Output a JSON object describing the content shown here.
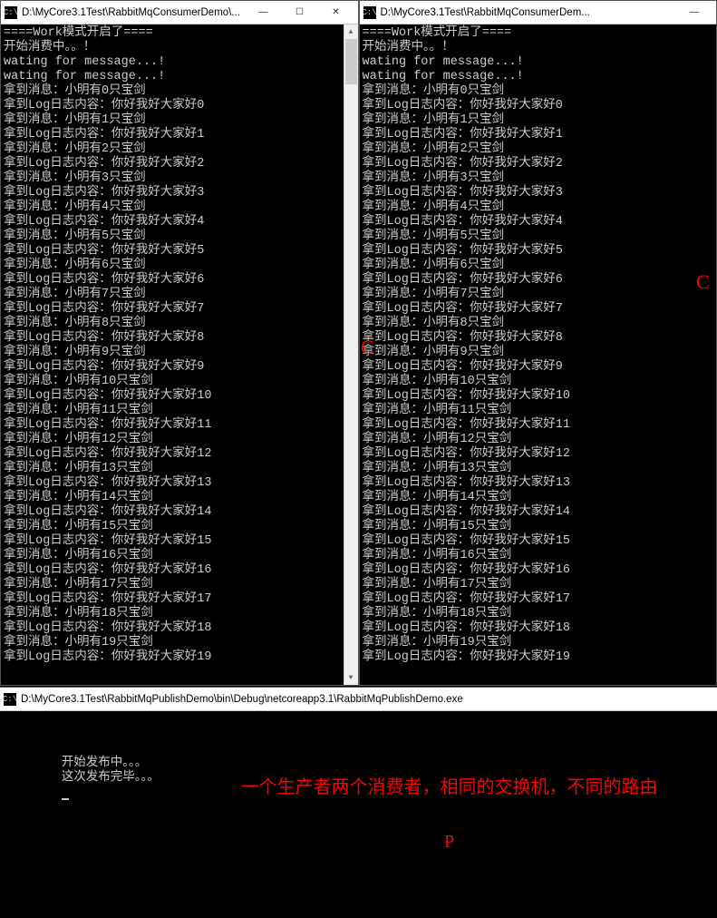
{
  "left": {
    "title": "D:\\MyCore3.1Test\\RabbitMqConsumerDemo\\...",
    "marker": "C",
    "lines": [
      "====Work模式开启了====",
      "开始消费中。。！",
      "wating for message...!",
      "wating for message...!",
      "拿到消息：小明有0只宝剑",
      "拿到Log日志内容：你好我好大家好0",
      "拿到消息：小明有1只宝剑",
      "拿到Log日志内容：你好我好大家好1",
      "拿到消息：小明有2只宝剑",
      "拿到Log日志内容：你好我好大家好2",
      "拿到消息：小明有3只宝剑",
      "拿到Log日志内容：你好我好大家好3",
      "拿到消息：小明有4只宝剑",
      "拿到Log日志内容：你好我好大家好4",
      "拿到消息：小明有5只宝剑",
      "拿到Log日志内容：你好我好大家好5",
      "拿到消息：小明有6只宝剑",
      "拿到Log日志内容：你好我好大家好6",
      "拿到消息：小明有7只宝剑",
      "拿到Log日志内容：你好我好大家好7",
      "拿到消息：小明有8只宝剑",
      "拿到Log日志内容：你好我好大家好8",
      "拿到消息：小明有9只宝剑",
      "拿到Log日志内容：你好我好大家好9",
      "拿到消息：小明有10只宝剑",
      "拿到Log日志内容：你好我好大家好10",
      "拿到消息：小明有11只宝剑",
      "拿到Log日志内容：你好我好大家好11",
      "拿到消息：小明有12只宝剑",
      "拿到Log日志内容：你好我好大家好12",
      "拿到消息：小明有13只宝剑",
      "拿到Log日志内容：你好我好大家好13",
      "拿到消息：小明有14只宝剑",
      "拿到Log日志内容：你好我好大家好14",
      "拿到消息：小明有15只宝剑",
      "拿到Log日志内容：你好我好大家好15",
      "拿到消息：小明有16只宝剑",
      "拿到Log日志内容：你好我好大家好16",
      "拿到消息：小明有17只宝剑",
      "拿到Log日志内容：你好我好大家好17",
      "拿到消息：小明有18只宝剑",
      "拿到Log日志内容：你好我好大家好18",
      "拿到消息：小明有19只宝剑",
      "拿到Log日志内容：你好我好大家好19"
    ]
  },
  "right": {
    "title": "D:\\MyCore3.1Test\\RabbitMqConsumerDem...",
    "marker": "C",
    "lines": [
      "====Work模式开启了====",
      "开始消费中。。！",
      "wating for message...!",
      "wating for message...!",
      "拿到消息：小明有0只宝剑",
      "拿到Log日志内容：你好我好大家好0",
      "拿到消息：小明有1只宝剑",
      "拿到Log日志内容：你好我好大家好1",
      "拿到消息：小明有2只宝剑",
      "拿到Log日志内容：你好我好大家好2",
      "拿到消息：小明有3只宝剑",
      "拿到Log日志内容：你好我好大家好3",
      "拿到消息：小明有4只宝剑",
      "拿到Log日志内容：你好我好大家好4",
      "拿到消息：小明有5只宝剑",
      "拿到Log日志内容：你好我好大家好5",
      "拿到消息：小明有6只宝剑",
      "拿到Log日志内容：你好我好大家好6",
      "拿到消息：小明有7只宝剑",
      "拿到Log日志内容：你好我好大家好7",
      "拿到消息：小明有8只宝剑",
      "拿到Log日志内容：你好我好大家好8",
      "拿到消息：小明有9只宝剑",
      "拿到Log日志内容：你好我好大家好9",
      "拿到消息：小明有10只宝剑",
      "拿到Log日志内容：你好我好大家好10",
      "拿到消息：小明有11只宝剑",
      "拿到Log日志内容：你好我好大家好11",
      "拿到消息：小明有12只宝剑",
      "拿到Log日志内容：你好我好大家好12",
      "拿到消息：小明有13只宝剑",
      "拿到Log日志内容：你好我好大家好13",
      "拿到消息：小明有14只宝剑",
      "拿到Log日志内容：你好我好大家好14",
      "拿到消息：小明有15只宝剑",
      "拿到Log日志内容：你好我好大家好15",
      "拿到消息：小明有16只宝剑",
      "拿到Log日志内容：你好我好大家好16",
      "拿到消息：小明有17只宝剑",
      "拿到Log日志内容：你好我好大家好17",
      "拿到消息：小明有18只宝剑",
      "拿到Log日志内容：你好我好大家好18",
      "拿到消息：小明有19只宝剑",
      "拿到Log日志内容：你好我好大家好19"
    ]
  },
  "bottom": {
    "title": "D:\\MyCore3.1Test\\RabbitMqPublishDemo\\bin\\Debug\\netcoreapp3.1\\RabbitMqPublishDemo.exe",
    "lines": [
      "开始发布中。。。",
      "这次发布完毕。。。"
    ],
    "annotation": "一个生产者两个消费者，相同的交换机，不同的路由",
    "marker": "P"
  },
  "controls": {
    "min": "—",
    "max": "☐",
    "close": "✕"
  }
}
